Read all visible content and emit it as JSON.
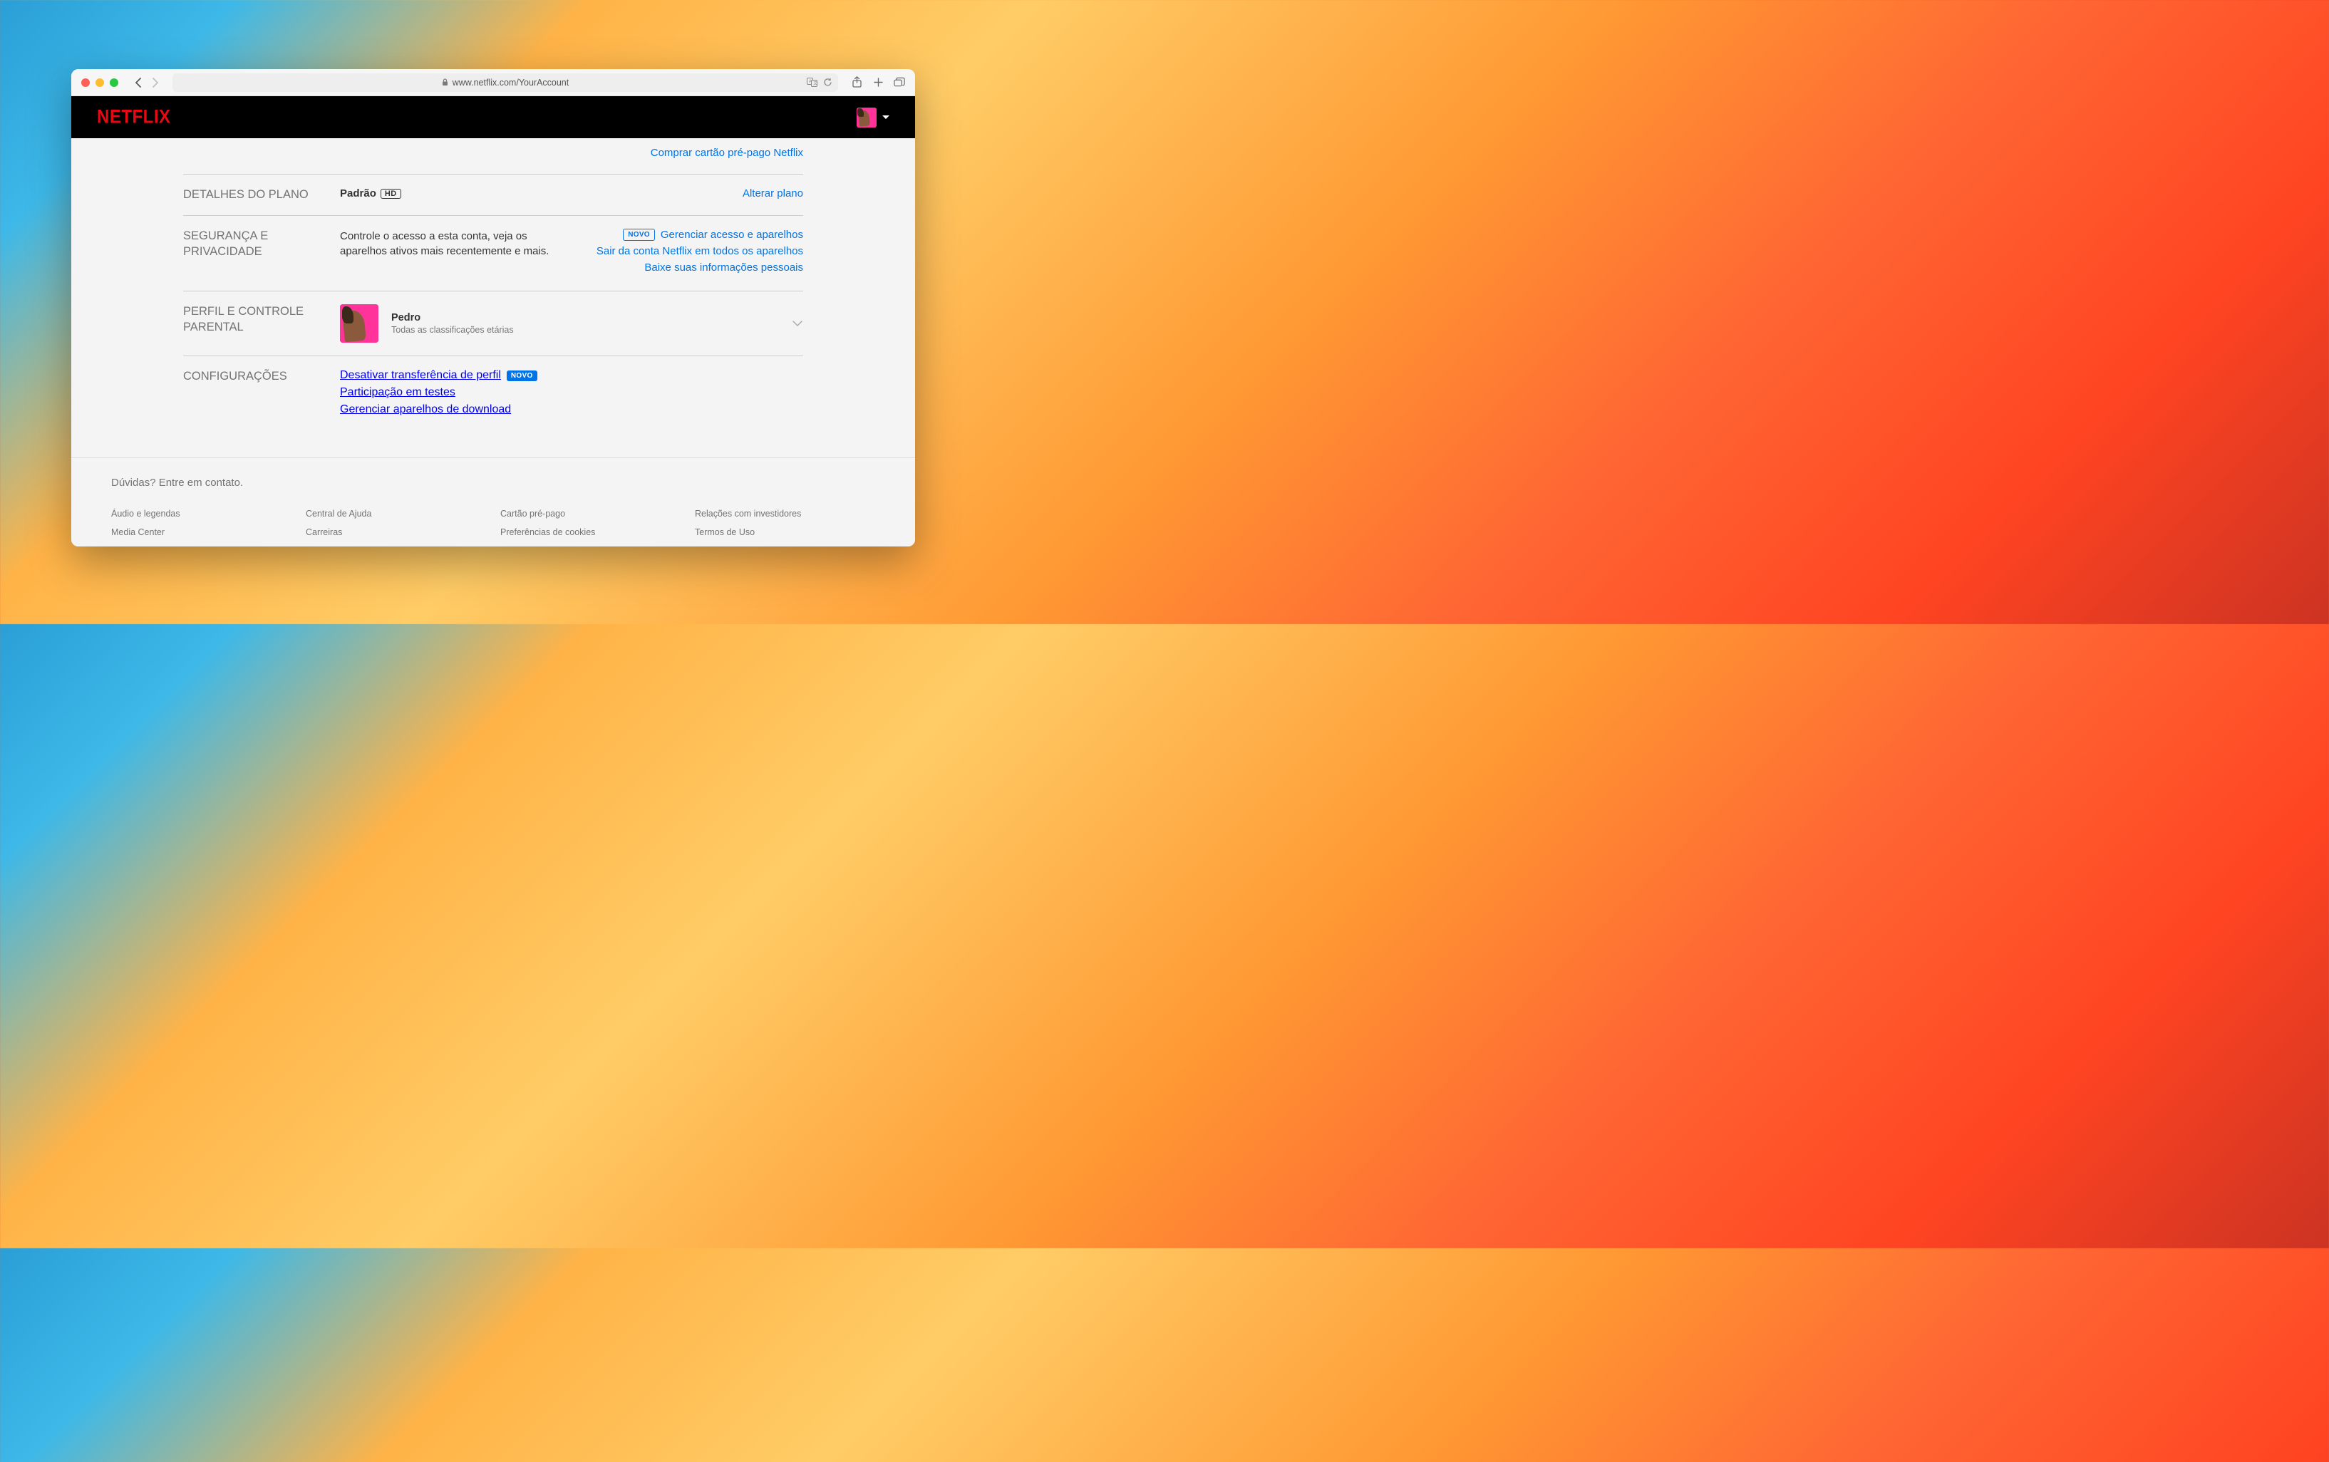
{
  "browser": {
    "url": "www.netflix.com/YourAccount"
  },
  "header": {
    "logo": "NETFLIX"
  },
  "preSection": {
    "prepaidCard": "Comprar cartão pré-pago Netflix"
  },
  "plan": {
    "label": "DETALHES DO PLANO",
    "name": "Padrão",
    "badge": "HD",
    "changeLink": "Alterar plano"
  },
  "security": {
    "label": "SEGURANÇA E PRIVACIDADE",
    "description": "Controle o acesso a esta conta, veja os aparelhos ativos mais recentemente e mais.",
    "badgeNew": "NOVO",
    "links": {
      "manageAccess": "Gerenciar acesso e aparelhos",
      "signOutAll": "Sair da conta Netflix em todos os aparelhos",
      "downloadInfo": "Baixe suas informações pessoais"
    }
  },
  "profiles": {
    "label": "PERFIL E CONTROLE PARENTAL",
    "profile": {
      "name": "Pedro",
      "rating": "Todas as classificações etárias"
    }
  },
  "settings": {
    "label": "CONFIGURAÇÕES",
    "badgeNew": "NOVO",
    "links": {
      "disableTransfer": "Desativar transferência de perfil",
      "testParticipation": "Participação em testes",
      "manageDownloads": "Gerenciar aparelhos de download"
    }
  },
  "footer": {
    "contact": "Dúvidas? Entre em contato.",
    "col1": {
      "a": "Áudio e legendas",
      "b": "Media Center"
    },
    "col2": {
      "a": "Central de Ajuda",
      "b": "Carreiras"
    },
    "col3": {
      "a": "Cartão pré-pago",
      "b": "Preferências de cookies"
    },
    "col4": {
      "a": "Relações com investidores",
      "b": "Termos de Uso"
    }
  }
}
